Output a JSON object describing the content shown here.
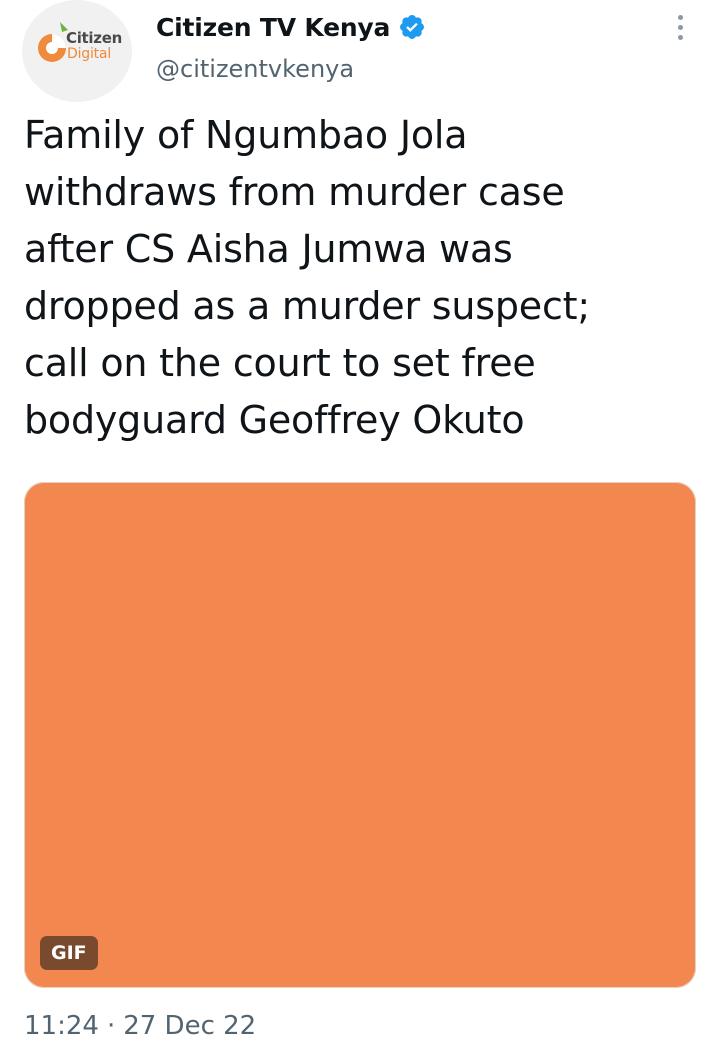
{
  "author": {
    "display_name": "Citizen TV Kenya",
    "handle": "@citizentvkenya",
    "verified": true,
    "avatar": {
      "logo_line_1": "Citizen",
      "logo_line_2": "Digital",
      "brand_color": "#f08a3c"
    }
  },
  "tweet": {
    "text": "Family of Ngumbao Jola\nwithdraws from murder case\nafter CS Aisha Jumwa was\ndropped as a murder suspect;\ncall on the court to set free\nbodyguard Geoffrey Okuto"
  },
  "media": {
    "type_badge": "GIF",
    "background_color": "#f2884f"
  },
  "meta": {
    "time": "11:24",
    "separator": "·",
    "date": "27 Dec 22"
  },
  "icons": {
    "more": "more-vertical-icon",
    "verified": "verified-badge-icon"
  },
  "colors": {
    "verified_blue": "#1d9bf0",
    "secondary_text": "#536471"
  }
}
